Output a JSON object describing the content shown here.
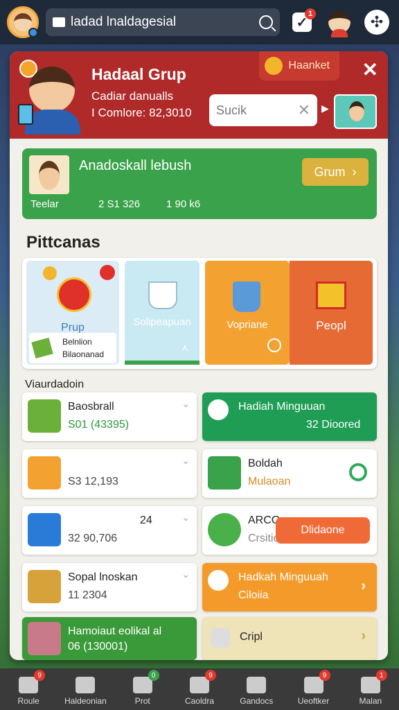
{
  "topbar": {
    "search_text": "ladad lnaldagesial",
    "notif_count": "1"
  },
  "header": {
    "title": "Hadaal Grup",
    "line1": "Cadiar danualls",
    "line2": "I Comlore: 82,3010",
    "pill_label": "Haanket",
    "search_placeholder": "Sucik"
  },
  "green_card": {
    "title": "Anadoskall lebush",
    "stat1": "Teelar",
    "stat2": "2 S1 326",
    "stat3": "1 90 k6",
    "button": "Grum"
  },
  "section_title": "Pittcanas",
  "features": [
    {
      "label": "Prup",
      "mini_line1": "Belnlion",
      "mini_line2": "Bilaonanad"
    },
    {
      "label": "Solipeapuan"
    },
    {
      "label": "Vopriane"
    },
    {
      "label": "Peopl"
    }
  ],
  "sub_title": "Viaurdadoin",
  "cards_left": [
    {
      "t1": "Baosbrall",
      "t2": "S01  (43395)"
    },
    {
      "t1": "",
      "t2": "S3  12,193"
    },
    {
      "t1": "24",
      "t2": "32  90,706"
    },
    {
      "t1": "Sopal lnoskan",
      "t2": "11  2304"
    },
    {
      "t1": "Hamoiaut eolikal  al",
      "t2": "06  (130001)"
    }
  ],
  "cards_right": [
    {
      "t1": "Hadiah Minguuan",
      "t2": "32 Dioored"
    },
    {
      "t1": "Boldah",
      "t2": "Mulaoan"
    },
    {
      "t1": "ARCO",
      "t2": "Crsitio",
      "action": "Dlidaone"
    },
    {
      "t1": "Hadkah Minguuah",
      "t2": "Ciloiia"
    },
    {
      "t1": "Cripl",
      "t2": ""
    }
  ],
  "nav": [
    {
      "label": "Roule",
      "badge": "9"
    },
    {
      "label": "Haldeonian",
      "badge": ""
    },
    {
      "label": "Prot",
      "badge": "0"
    },
    {
      "label": "Caoldra",
      "badge": "9"
    },
    {
      "label": "Gandocs",
      "badge": ""
    },
    {
      "label": "Ueoftker",
      "badge": "9"
    },
    {
      "label": "Malan",
      "badge": "1"
    }
  ]
}
